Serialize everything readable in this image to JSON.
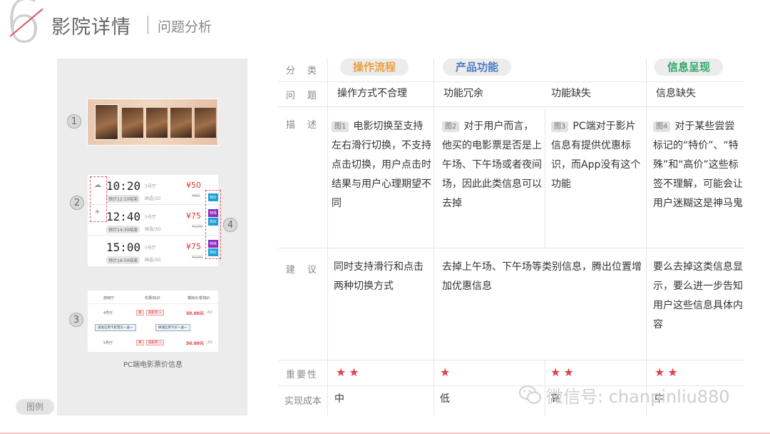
{
  "header": {
    "chapter_number": "6",
    "title": "影院详情",
    "subtitle": "问题分析"
  },
  "figures": {
    "markers": [
      "1",
      "2",
      "3",
      "4"
    ],
    "fig2_rows": [
      {
        "time": "10:20",
        "end": "预计12:10结束",
        "hall": "5号厅",
        "format": "国语/3D",
        "price": "¥50",
        "original": "¥60",
        "tags": []
      },
      {
        "time": "12:40",
        "end": "预计14:30结束",
        "hall": "5号厅",
        "format": "国语/3D",
        "price": "¥75",
        "original": "¥100",
        "tags": [
          "特殊",
          "高价"
        ]
      },
      {
        "time": "15:00",
        "end": "预计16:50结束",
        "hall": "5号厅",
        "format": "国语/3D",
        "price": "¥75",
        "original": "¥100",
        "tags": [
          "特殊",
          "高价"
        ]
      }
    ],
    "fig2_top_tag": "特价",
    "fig3": {
      "col_hall": "放映厅",
      "col_offer": "优惠/标识",
      "col_price": "模拟价/影院价",
      "row1_hall": "4号厅",
      "row1_tag1": "惠",
      "row1_tag2": "观影券 >",
      "row1_price": "50.00元",
      "row1_orig": "/60",
      "btn1": "浦发信用卡影票买一送一",
      "btn2": "邮储信用卡买一送一",
      "row2_hall": "5号厅",
      "row2_tag1": "惠",
      "row2_tag2": "观影券 >",
      "row2_price": "50.00元",
      "row2_orig": "/60"
    },
    "fig3_caption": "PC端电影票价信息",
    "legend": "图例"
  },
  "table": {
    "row_labels": {
      "category": "分　类",
      "problem": "问　题",
      "description": "描　述",
      "suggestion": "建　议",
      "importance": "重要性",
      "cost": "实现成本"
    },
    "categories": [
      {
        "label": "操作流程",
        "color": "#e8a040"
      },
      {
        "label": "产品功能",
        "color": "#4a7cc0"
      },
      {
        "label": "信息呈现",
        "color": "#2ea868"
      }
    ],
    "problems": [
      "操作方式不合理",
      "功能冗余",
      "功能缺失",
      "信息缺失"
    ],
    "descriptions": [
      {
        "tag": "图1",
        "text": "电影切换至支持左右滑行切换，不支持点击切换，用户点击时结果与用户心理期望不同"
      },
      {
        "tag": "图2",
        "text": "对于用户而言，他买的电影票是否是上午场、下午场或者夜间场，因此此类信息可以去掉"
      },
      {
        "tag": "图3",
        "text": "PC端对于影片信息有提供优惠标识，而App没有这个功能"
      },
      {
        "tag": "图4",
        "text": "对于某些尝尝标记的“特价”、“特殊”和“高价”这些标签不理解，可能会让用户迷糊这是神马鬼"
      }
    ],
    "suggestions": [
      "同时支持滑行和点击两种切换方式",
      "去掉上午场、下午场等类别信息，腾出位置增加优惠信息",
      "要么去掉这类信息显示，要么进一步告知用户这些信息具体内容"
    ],
    "importance": [
      "★★",
      "★",
      "★★",
      "★★"
    ],
    "cost": [
      "中",
      "低",
      "高",
      "中"
    ]
  },
  "watermark": "微信号: chanpinliu880",
  "colors": {
    "accent": "#e05560",
    "star": "#e04050"
  }
}
